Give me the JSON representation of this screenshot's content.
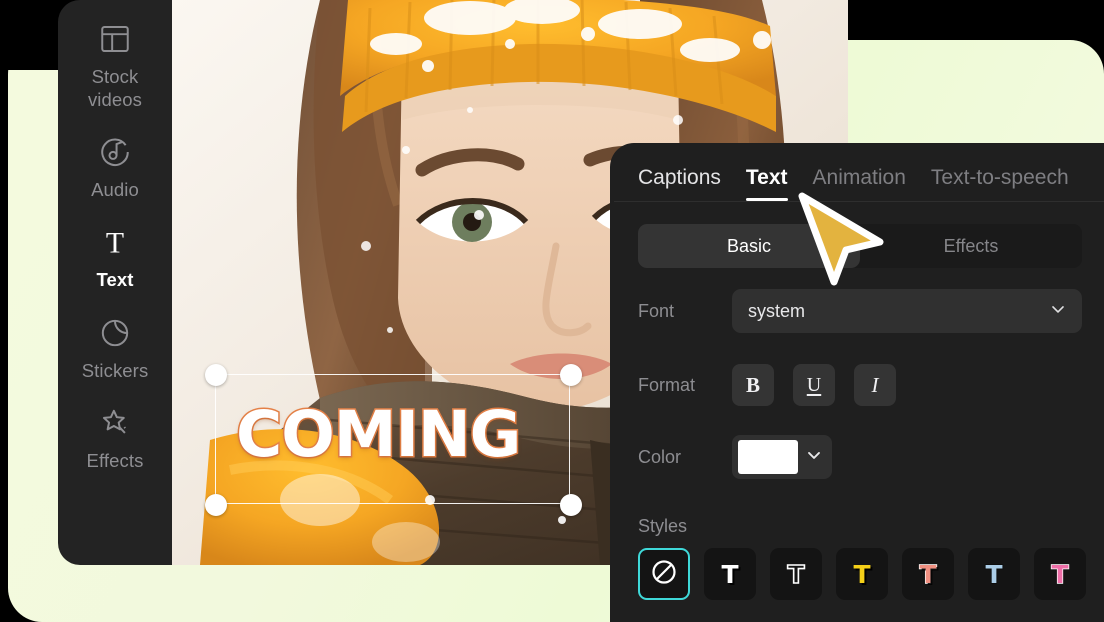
{
  "app": {
    "background_color": "#f2f9dd",
    "panel_bg": "#1f1f1f",
    "sidebar_bg": "#232323",
    "accent_selected": "#3fd9d9",
    "cursor_color": "#e3b33f"
  },
  "sidebar": {
    "items": [
      {
        "label": "Stock\nvideos",
        "label_line1": "Stock",
        "label_line2": "videos",
        "icon": "layout-grid-icon",
        "active": false
      },
      {
        "label": "Audio",
        "icon": "audio-note-circle-icon",
        "active": false
      },
      {
        "label": "Text",
        "icon": "text-t-icon",
        "active": true
      },
      {
        "label": "Stickers",
        "icon": "sticker-circle-icon",
        "active": false
      },
      {
        "label": "Effects",
        "icon": "star-sparkle-icon",
        "active": false
      }
    ]
  },
  "preview": {
    "overlay_text": "COMING",
    "overlay_text_color": "#ffffff",
    "overlay_outline_color": "#e8844a",
    "selection_handles": 4
  },
  "panel": {
    "tabs": [
      {
        "label": "Captions",
        "active": false
      },
      {
        "label": "Text",
        "active": true
      },
      {
        "label": "Animation",
        "active": false
      },
      {
        "label": "Text-to-speech",
        "active": false
      }
    ],
    "segmented": [
      {
        "label": "Basic",
        "active": true
      },
      {
        "label": "Effects",
        "active": false
      }
    ],
    "font": {
      "label": "Font",
      "value": "system",
      "chevron": "chevron-down-icon"
    },
    "format": {
      "label": "Format",
      "buttons": [
        {
          "name": "bold",
          "glyph": "B"
        },
        {
          "name": "underline",
          "glyph": "U"
        },
        {
          "name": "italic",
          "glyph": "I"
        }
      ]
    },
    "color": {
      "label": "Color",
      "value": "#ffffff",
      "chevron": "chevron-down-icon"
    },
    "styles": {
      "label": "Styles",
      "tiles": [
        {
          "name": "none",
          "icon": "no-style-icon",
          "selected": true,
          "fill": "#ffffff",
          "stroke": ""
        },
        {
          "name": "white-solid",
          "icon": "text-style-icon",
          "selected": false,
          "fill": "#ffffff",
          "stroke": "#000000"
        },
        {
          "name": "outline",
          "icon": "text-style-icon",
          "selected": false,
          "fill": "transparent",
          "stroke": "#ffffff"
        },
        {
          "name": "yellow",
          "icon": "text-style-icon",
          "selected": false,
          "fill": "#f5d018",
          "stroke": "#000000"
        },
        {
          "name": "salmon",
          "icon": "text-style-icon",
          "selected": false,
          "fill": "#f19081",
          "stroke": "#ffffff"
        },
        {
          "name": "light-blue",
          "icon": "text-style-icon",
          "selected": false,
          "fill": "#accee8",
          "stroke": "#111111"
        },
        {
          "name": "pink",
          "icon": "text-style-icon",
          "selected": false,
          "fill": "#ef6fa8",
          "stroke": "#ffffff"
        }
      ]
    }
  }
}
